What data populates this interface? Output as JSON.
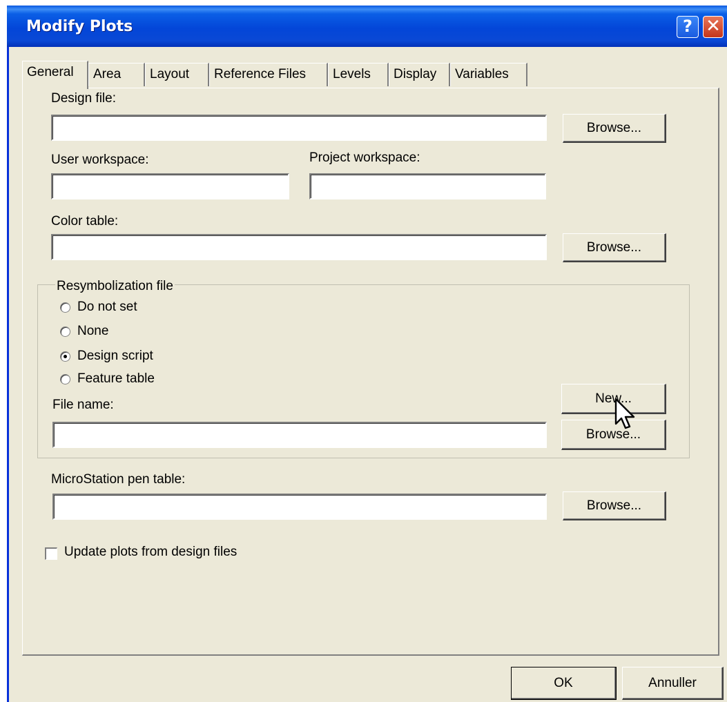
{
  "window": {
    "title": "Modify Plots",
    "help_glyph": "?",
    "close_glyph": "✕"
  },
  "tabs": [
    {
      "label": "General",
      "active": true
    },
    {
      "label": "Area"
    },
    {
      "label": "Layout"
    },
    {
      "label": "Reference Files"
    },
    {
      "label": "Levels"
    },
    {
      "label": "Display"
    },
    {
      "label": "Variables"
    }
  ],
  "general": {
    "design_file_label": "Design file:",
    "design_file_value": "",
    "browse_label": "Browse...",
    "user_workspace_label": "User workspace:",
    "user_workspace_value": "",
    "project_workspace_label": "Project workspace:",
    "project_workspace_value": "",
    "color_table_label": "Color table:",
    "color_table_value": "",
    "resym_group_label": "Resymbolization file",
    "radio_options": [
      {
        "label": "Do not set",
        "checked": false
      },
      {
        "label": "None",
        "checked": false
      },
      {
        "label": "Design script",
        "checked": true
      },
      {
        "label": "Feature table",
        "checked": false
      }
    ],
    "file_name_label": "File name:",
    "file_name_value": "",
    "new_label": "New...",
    "pen_table_label": "MicroStation pen table:",
    "pen_table_value": "",
    "update_plots_label": "Update plots from design files",
    "update_plots_checked": false
  },
  "footer": {
    "ok_label": "OK",
    "cancel_label": "Annuller"
  }
}
